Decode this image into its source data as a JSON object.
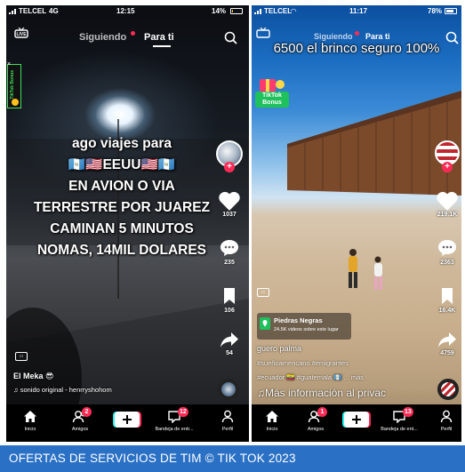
{
  "left_phone": {
    "status": {
      "carrier": "TELCEL",
      "network": "4G",
      "time": "12:15",
      "battery": "14%",
      "battery_level": 0.14
    },
    "nav": {
      "live": "LIVE",
      "following": "Siguiendo",
      "for_you": "Para ti"
    },
    "bonus": {
      "line1": "TikTok",
      "line2": "Bonus"
    },
    "caption": [
      "ago viajes para",
      "🇬🇹🇺🇸EEUU🇺🇸🇬🇹",
      "EN AVION O VIA",
      "TERRESTRE POR JUAREZ",
      "CAMINAN 5 MINUTOS",
      "NOMAS, 14MIL DOLARES"
    ],
    "counts": {
      "likes": "1037",
      "comments": "235",
      "saves": "106",
      "shares": "54"
    },
    "username": "El Meka 😎",
    "sound": "sonido original - henrryshohom",
    "bottom_nav": {
      "home": "Inicio",
      "friends": "Amigos",
      "friends_badge": "2",
      "inbox": "Bandeja de entr...",
      "inbox_badge": "12",
      "profile": "Perfil"
    }
  },
  "right_phone": {
    "status": {
      "carrier": "TELCEL",
      "time": "11:17",
      "battery": "78%",
      "battery_level": 0.78
    },
    "nav": {
      "live": "LIVE",
      "following": "Siguiendo",
      "for_you": "Para ti"
    },
    "overlay_title": "6500 el brinco seguro 100%",
    "bonus": {
      "line1": "TikTok",
      "line2": "Bonus"
    },
    "counts": {
      "likes": "219.1K",
      "comments": "2363",
      "saves": "16.4K",
      "shares": "4759"
    },
    "location": {
      "name": "Piedras Negras",
      "subtitle": "24.5K videos sobre este lugar"
    },
    "username": "guero palma",
    "hashtags_1": "#sueñoamericano #emigrantes",
    "hashtags_2": "#ecuador 🇪🇨 #guatemala 🇬🇹 ... más",
    "watermark": "Más información al privac",
    "bottom_nav": {
      "home": "Inicio",
      "friends": "Amigos",
      "friends_badge": "1",
      "inbox": "Bandeja de ent...",
      "inbox_badge": "13",
      "profile": "Perfil"
    }
  },
  "footer": "OFERTAS DE SERVICIOS DE TIM © TIK TOK 2023",
  "colors": {
    "accent_red": "#ff2b55",
    "footer_blue": "#2a70c5",
    "cyan": "#25f4ee"
  }
}
